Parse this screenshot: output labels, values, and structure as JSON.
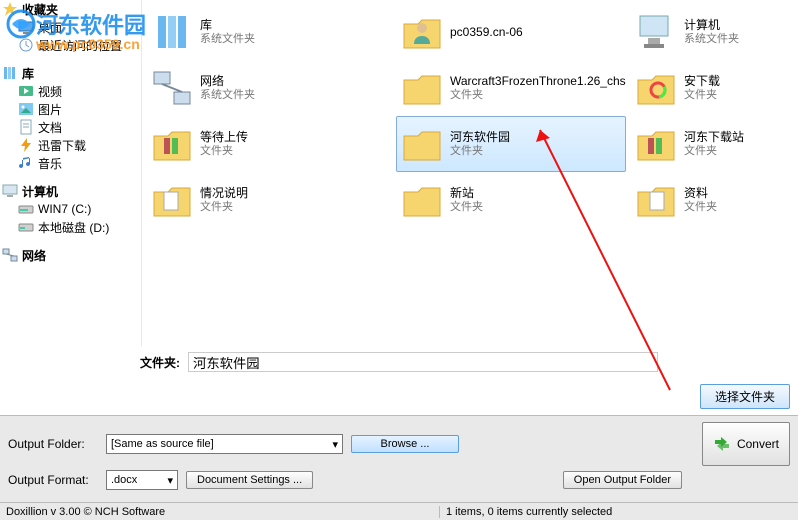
{
  "watermark": {
    "text": "河东软件园",
    "url": "www.pc0359.cn"
  },
  "sidebar": {
    "items": [
      {
        "label": "收藏夹",
        "icon": "fav",
        "level": 0
      },
      {
        "label": "桌面",
        "icon": "desktop",
        "level": 1
      },
      {
        "label": "最近访问的位置",
        "icon": "recent",
        "level": 1
      },
      {
        "label": "库",
        "icon": "library",
        "level": 0
      },
      {
        "label": "视频",
        "icon": "video",
        "level": 1
      },
      {
        "label": "图片",
        "icon": "picture",
        "level": 1
      },
      {
        "label": "文档",
        "icon": "document",
        "level": 1
      },
      {
        "label": "迅雷下载",
        "icon": "thunder",
        "level": 1
      },
      {
        "label": "音乐",
        "icon": "music",
        "level": 1
      },
      {
        "label": "计算机",
        "icon": "computer",
        "level": 0
      },
      {
        "label": "WIN7 (C:)",
        "icon": "drive",
        "level": 1
      },
      {
        "label": "本地磁盘 (D:)",
        "icon": "drive",
        "level": 1
      },
      {
        "label": "网络",
        "icon": "network",
        "level": 0
      }
    ]
  },
  "files": {
    "col1": [
      {
        "name": "库",
        "type": "系统文件夹",
        "icon": "library"
      },
      {
        "name": "网络",
        "type": "系统文件夹",
        "icon": "network"
      },
      {
        "name": "等待上传",
        "type": "文件夹",
        "icon": "folder-docs"
      },
      {
        "name": "情况说明",
        "type": "文件夹",
        "icon": "folder-docs"
      }
    ],
    "col2": [
      {
        "name": "pc0359.cn-06",
        "type": "",
        "icon": "user"
      },
      {
        "name": "Warcraft3FrozenThrone1.26_chs",
        "type": "文件夹",
        "icon": "folder"
      },
      {
        "name": "河东软件园",
        "type": "文件夹",
        "icon": "folder",
        "selected": true
      },
      {
        "name": "新站",
        "type": "文件夹",
        "icon": "folder"
      }
    ],
    "col3": [
      {
        "name": "计算机",
        "type": "系统文件夹",
        "icon": "computer"
      },
      {
        "name": "安下载",
        "type": "文件夹",
        "icon": "folder-star"
      },
      {
        "name": "河东下载站",
        "type": "文件夹",
        "icon": "folder-docs"
      },
      {
        "name": "资料",
        "type": "文件夹",
        "icon": "folder-page"
      }
    ]
  },
  "folder_row": {
    "label": "文件夹:",
    "value": "河东软件园"
  },
  "select_folder_label": "选择文件夹",
  "output": {
    "folder_label": "Output Folder:",
    "folder_value": "[Same as source file]",
    "browse_label": "Browse ...",
    "format_label": "Output Format:",
    "format_value": ".docx",
    "doc_settings_label": "Document Settings ...",
    "open_folder_label": "Open Output Folder",
    "convert_label": "Convert"
  },
  "status": {
    "left": "Doxillion v 3.00  © NCH Software",
    "right": "1 items, 0 items currently selected"
  }
}
